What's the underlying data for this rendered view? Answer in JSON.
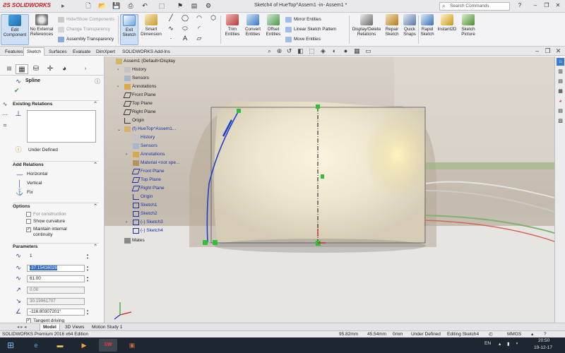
{
  "app": {
    "brand": "SOLIDWORKS",
    "title": "Sketch4 of HueTop^Assem1 -in- Assem1 *",
    "search_placeholder": "Search Commands"
  },
  "command_manager": {
    "edit_component": "Edit Component",
    "no_external_refs": "No External References",
    "hide_show_components": "Hide/Show Components",
    "change_transparency": "Change Transparency",
    "assembly_transparency": "Assembly Transparency",
    "exit_sketch": "Exit Sketch",
    "smart_dimension": "Smart Dimension",
    "trim_entities": "Trim Entities",
    "convert_entities": "Convert Entities",
    "offset_entities": "Offset Entities",
    "mirror_entities": "Mirror Entities",
    "linear_sketch_pattern": "Linear Sketch Pattern",
    "move_entities": "Move Entities",
    "display_delete_relations": "Display/Delete Relations",
    "repair_sketch": "Repair Sketch",
    "quick_snaps": "Quick Snaps",
    "rapid_sketch": "Rapid Sketch",
    "instant2d": "Instant2D",
    "sketch_picture": "Sketch Picture"
  },
  "tabs": [
    "Features",
    "Sketch",
    "Surfaces",
    "Evaluate",
    "DimXpert",
    "SOLIDWORKS Add-Ins"
  ],
  "active_tab": "Sketch",
  "property_manager": {
    "title": "Spline",
    "existing_relations": "Existing Relations",
    "under_defined": "Under Defined",
    "add_relations": "Add Relations",
    "relations": [
      "Horizontal",
      "Vertical",
      "Fix"
    ],
    "options": "Options",
    "for_construction": "For construction",
    "show_curvature": "Show curvature",
    "maintain_continuity": "Maintain internal continuity",
    "parameters": "Parameters",
    "param_point": "1",
    "param_x": "-37.15416028",
    "param_y": "61.00",
    "param_a": "0.00",
    "param_b": "30.19961707",
    "param_angle": "-116.80307201°",
    "tangent_driving": "Tangent driving"
  },
  "tree": {
    "root": "Assem1 (Default<Display",
    "items": [
      "History",
      "Sensors",
      "Annotations",
      "Front Plane",
      "Top Plane",
      "Right Plane",
      "Origin"
    ],
    "component": "(f) HueTop^Assem1...",
    "sub_items": [
      "History",
      "Sensors",
      "Annotations",
      "Material <not spe...",
      "Front Plane",
      "Top Plane",
      "Right Plane",
      "Origin",
      "Sketch1",
      "Sketch2",
      "(-) Sketch3",
      "(-) Sketch4"
    ],
    "mates": "Mates"
  },
  "bottom_tabs": [
    "Model",
    "3D Views",
    "Motion Study 1"
  ],
  "active_bottom_tab": "Model",
  "status": {
    "edition": "SOLIDWORKS Premium 2016 x64 Edition",
    "x": "95.82mm",
    "y": "45.54mm",
    "z": "0mm",
    "defined": "Under Defined",
    "editing": "Editing Sketch4",
    "units": "MMGS"
  },
  "taskbar": {
    "lang": "EN",
    "time": "20:50",
    "date": "19-12-17"
  },
  "colors": {
    "accent": "#3168c6",
    "brand": "#c8201e",
    "spline": "#1f3fd0",
    "point": "#2fbf3a"
  }
}
